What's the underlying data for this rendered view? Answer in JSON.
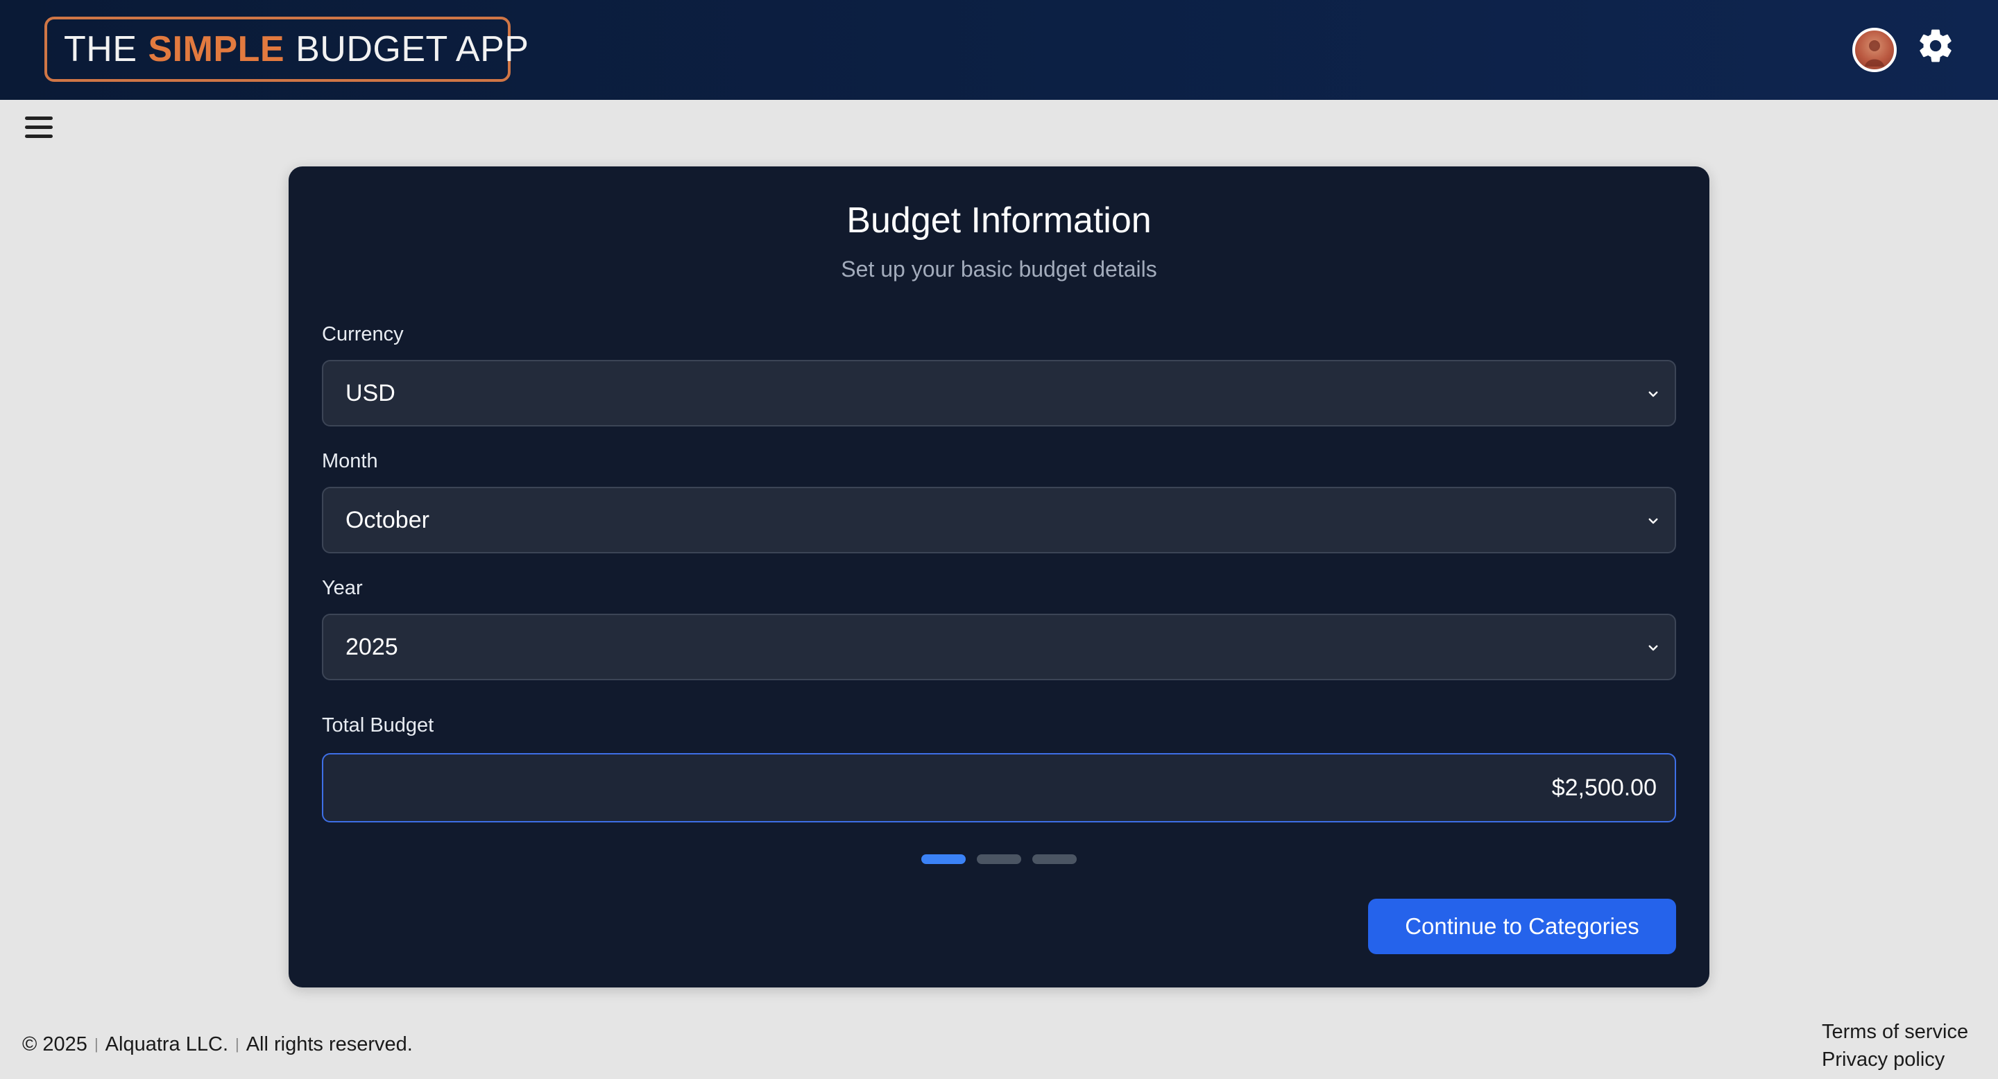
{
  "header": {
    "logo": {
      "part1": "THE",
      "accent": "SIMPLE",
      "part2": "BUDGET APP"
    },
    "avatar_icon": "user-avatar",
    "settings_icon": "gear-icon"
  },
  "nav": {
    "menu_icon": "hamburger-menu-icon"
  },
  "card": {
    "title": "Budget Information",
    "subtitle": "Set up your basic budget details",
    "currency": {
      "label": "Currency",
      "value": "USD"
    },
    "month": {
      "label": "Month",
      "value": "October"
    },
    "year": {
      "label": "Year",
      "value": "2025"
    },
    "total_budget": {
      "label": "Total Budget",
      "value": "$2,500.00"
    },
    "steps": {
      "total": 3,
      "current": 1
    },
    "continue_label": "Continue to Categories"
  },
  "footer": {
    "copyright": "© 2025",
    "company": "Alquatra LLC.",
    "rights": "All rights reserved.",
    "separator": "|",
    "links": {
      "terms": "Terms of service",
      "privacy": "Privacy policy"
    }
  },
  "colors": {
    "header_bg": "#0a1a36",
    "logo_accent": "#e27a3f",
    "card_bg": "#111a2d",
    "input_bg": "#232b3b",
    "primary_button": "#2563eb",
    "step_active": "#3b82f6",
    "step_inactive": "#4b5563"
  }
}
